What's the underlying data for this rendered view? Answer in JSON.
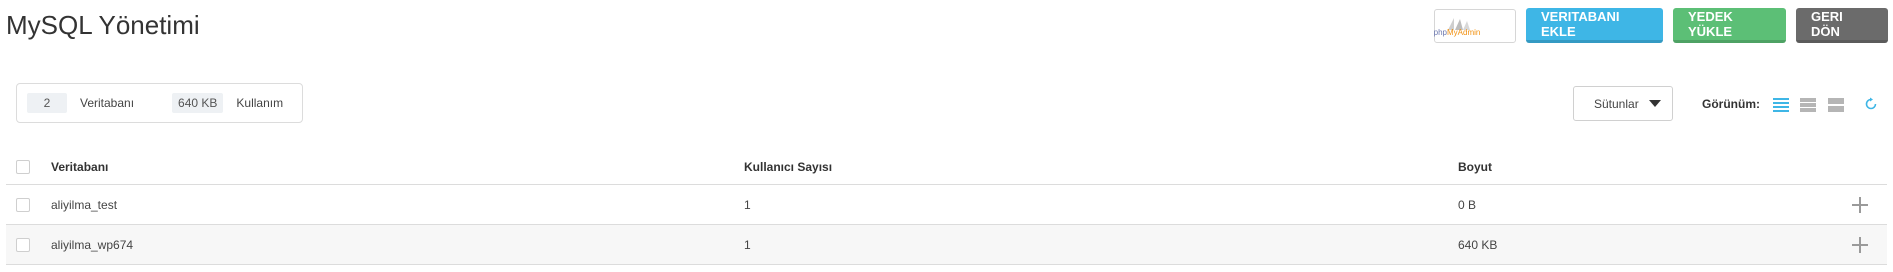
{
  "page": {
    "title": "MySQL Yönetimi"
  },
  "actions": {
    "phpmyadmin_logo_text_php": "php",
    "phpmyadmin_logo_text_myadmin": "MyAdmin",
    "add_db_label": "VERITABANI EKLE",
    "upload_backup_label": "YEDEK YÜKLE",
    "back_label": "GERI DÖN"
  },
  "stats": {
    "db_count": "2",
    "db_label": "Veritabanı",
    "usage": "640 KB",
    "usage_label": "Kullanım"
  },
  "toolbar": {
    "columns_label": "Sütunlar",
    "view_label": "Görünüm:"
  },
  "table": {
    "headers": [
      "Veritabanı",
      "Kullanıcı Sayısı",
      "Boyut"
    ],
    "rows": [
      {
        "name": "aliyilma_test",
        "users": "1",
        "size": "0 B"
      },
      {
        "name": "aliyilma_wp674",
        "users": "1",
        "size": "640 KB"
      }
    ]
  },
  "colors": {
    "accent_blue": "#3eb6e6",
    "accent_green": "#5cbf76",
    "accent_gray": "#6b6b6b",
    "active_view": "#3eb6e6"
  },
  "icons": [
    "phpmyadmin-logo-icon",
    "caret-down-icon",
    "list-view-icon",
    "compact-view-icon",
    "grid-view-icon",
    "refresh-icon",
    "plus-icon"
  ]
}
